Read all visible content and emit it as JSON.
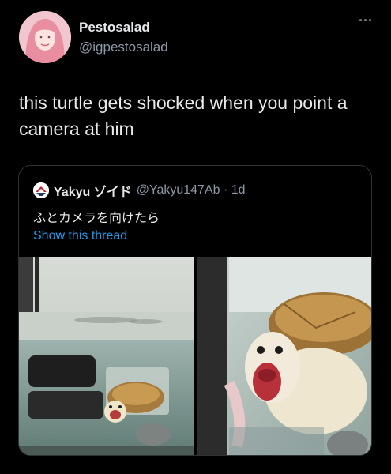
{
  "author": {
    "display_name": "Pestosalad",
    "handle": "@igpestosalad",
    "avatar_icon": "profile-photo-pink-hair"
  },
  "tweet": {
    "text": "this turtle gets shocked when you point a camera at him"
  },
  "quoted_tweet": {
    "display_name": "Yakyu ゾイド",
    "handle_time": "@Yakyu147Ab · 1d",
    "text": "ふとカメラを向けたら",
    "show_thread_label": "Show this thread",
    "images": [
      "turtle-in-aquarium-photo",
      "turtle-closeup-mouth-open-photo"
    ]
  },
  "colors": {
    "background": "#000000",
    "text": "#e7e9ea",
    "secondary": "#8b98a5",
    "link": "#1d9bf0",
    "border": "#2f3336"
  }
}
